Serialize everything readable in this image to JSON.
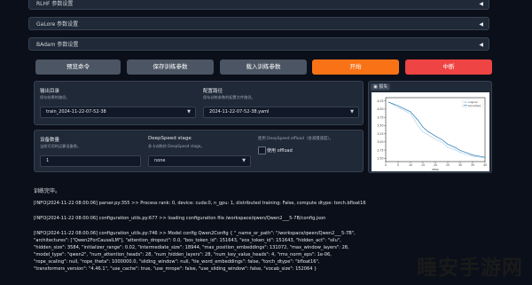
{
  "accordions": [
    {
      "label": "RLHF 参数设置"
    },
    {
      "label": "GaLore 参数设置"
    },
    {
      "label": "BAdam 参数设置"
    }
  ],
  "buttons": {
    "preview": "预览命令",
    "save": "保存训练参数",
    "load": "载入训练参数",
    "start": "开始",
    "abort": "中断"
  },
  "output": {
    "output_dir_label": "输出目录",
    "output_dir_hint": "保存结果的路径。",
    "output_dir_value": "train_2024-11-22-07-52-38",
    "config_path_label": "配置路径",
    "config_path_hint": "保存训练参数的配置文件路径。",
    "config_path_value": "2024-11-22-07-52-38.yaml"
  },
  "devices": {
    "label": "设备数量",
    "hint": "当前可用的运算设备数。",
    "value": "1",
    "ds_label": "DeepSpeed stage",
    "ds_hint": "多卡训练的 DeepSpeed stage。",
    "ds_value": "none",
    "offload_hint": "使用 DeepSpeed offload（会减慢速度）。",
    "offload_label": "使用 offload"
  },
  "chart": {
    "header": "损失",
    "legend": [
      "original",
      "smoothed"
    ],
    "xlabel": "step",
    "x_ticks": [
      "0",
      "5",
      "10",
      "15",
      "20",
      "25",
      "30",
      "35",
      "40"
    ],
    "y_ticks": [
      "4.25",
      "4.00",
      "3.75",
      "3.50",
      "3.25",
      "3.00",
      "2.75",
      "2.50"
    ],
    "colors": {
      "original": "#7fb3d5",
      "smoothed": "#1f77b4"
    }
  },
  "chart_data": {
    "type": "line",
    "title": "",
    "xlabel": "step",
    "ylabel": "",
    "xlim": [
      0,
      40
    ],
    "ylim": [
      2.4,
      4.35
    ],
    "series": [
      {
        "name": "original",
        "x": [
          1,
          5,
          10,
          13,
          15,
          17,
          20,
          23,
          25,
          28,
          30,
          33,
          35,
          38,
          40
        ],
        "y": [
          4.22,
          4.05,
          3.86,
          3.5,
          3.3,
          3.22,
          3.08,
          2.98,
          2.83,
          2.76,
          2.68,
          2.61,
          2.56,
          2.53,
          2.52
        ]
      },
      {
        "name": "smoothed",
        "x": [
          1,
          5,
          10,
          13,
          15,
          17,
          20,
          23,
          25,
          28,
          30,
          33,
          35,
          38,
          40
        ],
        "y": [
          4.22,
          4.1,
          3.92,
          3.66,
          3.45,
          3.32,
          3.18,
          3.05,
          2.93,
          2.83,
          2.74,
          2.66,
          2.6,
          2.56,
          2.53
        ]
      }
    ]
  },
  "log": {
    "finished": "训练完毕。",
    "lines": [
      "[INFO|2024-11-22 08:00:06] parser.py:355 >> Process rank: 0, device: cuda:0, n_gpu: 1, distributed training: False, compute dtype: torch.bfloat16",
      "[INFO|2024-11-22 08:00:06] configuration_utils.py:677 >> loading configuration file /workspace/qwen/Qwen2___5-7B/config.json",
      "[INFO|2024-11-22 08:00:06] configuration_utils.py:746 >> Model config Qwen2Config { \"_name_or_path\": \"/workspace/qwen/Qwen2___5-7B\",",
      "\"architectures\": [\"Qwen2ForCausalLM\"], \"attention_dropout\": 0.0, \"bos_token_id\": 151643, \"eos_token_id\": 151643, \"hidden_act\": \"silu\",",
      "\"hidden_size\": 3584, \"initializer_range\": 0.02, \"intermediate_size\": 18944, \"max_position_embeddings\": 131072, \"max_window_layers\": 28,",
      "\"model_type\": \"qwen2\", \"num_attention_heads\": 28, \"num_hidden_layers\": 28, \"num_key_value_heads\": 4, \"rms_norm_eps\": 1e-06,",
      "\"rope_scaling\": null, \"rope_theta\": 1000000.0, \"sliding_window\": null, \"tie_word_embeddings\": false, \"torch_dtype\": \"bfloat16\",",
      "\"transformers_version\": \"4.46.1\", \"use_cache\": true, \"use_mrope\": false, \"use_sliding_window\": false, \"vocab_size\": 152064 }"
    ]
  },
  "watermark": "睡安手游网"
}
